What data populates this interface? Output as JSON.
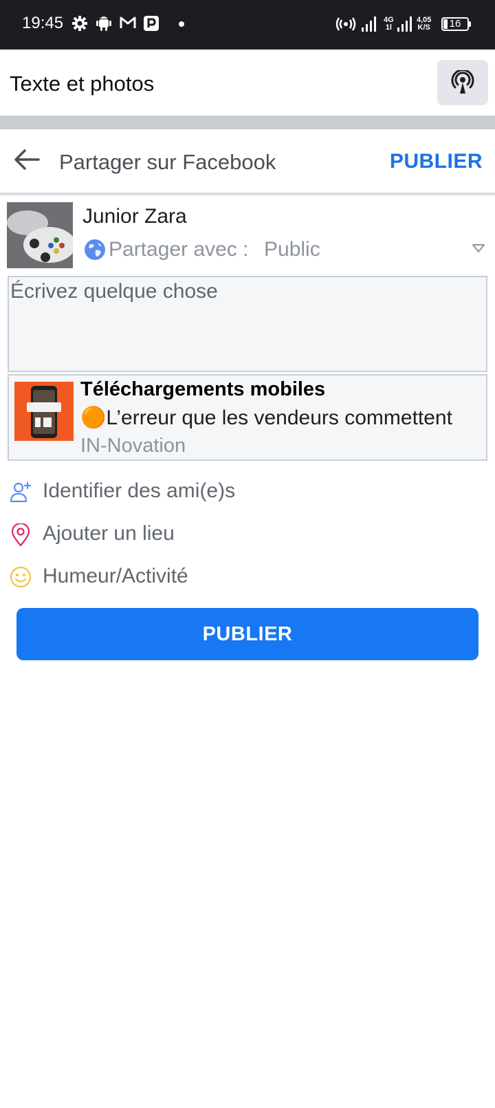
{
  "status_bar": {
    "time": "19:45",
    "network_type_top": "4G",
    "network_type_bottom": "1l",
    "speed_value": "4,05",
    "speed_unit": "K/S",
    "battery_level": "16",
    "battery_fraction": 0.16
  },
  "app_bar": {
    "title": "Texte et photos",
    "broadcast_icon": "broadcast-icon"
  },
  "facebook_header": {
    "title": "Partager sur Facebook",
    "publish_label": "PUBLIER"
  },
  "user": {
    "name": "Junior Zara",
    "share_with_label": "Partager avec :",
    "share_with_value": "Public"
  },
  "composer": {
    "placeholder": "Écrivez quelque chose"
  },
  "link_preview": {
    "title": "Téléchargements mobiles",
    "description": "🟠L’erreur que les vendeurs commettent",
    "source": "IN-Novation"
  },
  "options": [
    {
      "label": "Identifier des ami(e)s",
      "icon": "add-person-icon",
      "color": "#5b8def"
    },
    {
      "label": "Ajouter un lieu",
      "icon": "location-pin-icon",
      "color": "#e0245e"
    },
    {
      "label": "Humeur/Activité",
      "icon": "smiley-icon",
      "color": "#f5c33b"
    }
  ],
  "publish_button": {
    "label": "PUBLIER",
    "color": "#1877f2"
  }
}
